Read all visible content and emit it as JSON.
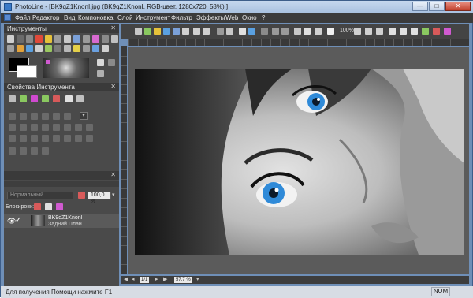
{
  "window": {
    "app_name": "PhotoLine",
    "title": "PhotoLine - [BK9qZ1KnonI.jpg (BK9qZ1KnonI, RGB-цвет, 1280x720, 58%) ]",
    "buttons": {
      "minimize": "—",
      "maximize": "□",
      "close": "✕"
    }
  },
  "menu": {
    "items": [
      "Файл",
      "Редактор",
      "Вид",
      "Компоновка",
      "Слой",
      "Инструмент",
      "Фильтр",
      "Эффекты",
      "Web",
      "Окно",
      "?"
    ]
  },
  "panels": {
    "tools": {
      "title": "Инструменты",
      "close": "✕"
    },
    "tool_properties": {
      "title": "Свойства Инструмента",
      "close": "✕"
    }
  },
  "layers": {
    "blend_mode": "Нормальный",
    "opacity": "100,0 %",
    "lock_label": "Блокировк:",
    "items": [
      {
        "name": "BK9qZ1KnonI",
        "sub": "Задний План"
      }
    ]
  },
  "toolbar": {
    "zoom_readout": "100%"
  },
  "navigation": {
    "page": "1/1",
    "zoom": "57,7 %"
  },
  "status": {
    "help_text": "Для получения Помощи нажмите F1",
    "num": "NUM"
  },
  "colors": {
    "accent": "#3a7ac8",
    "panel_bg": "#4a4a4a",
    "eye_blue": "#2f8ad8"
  }
}
